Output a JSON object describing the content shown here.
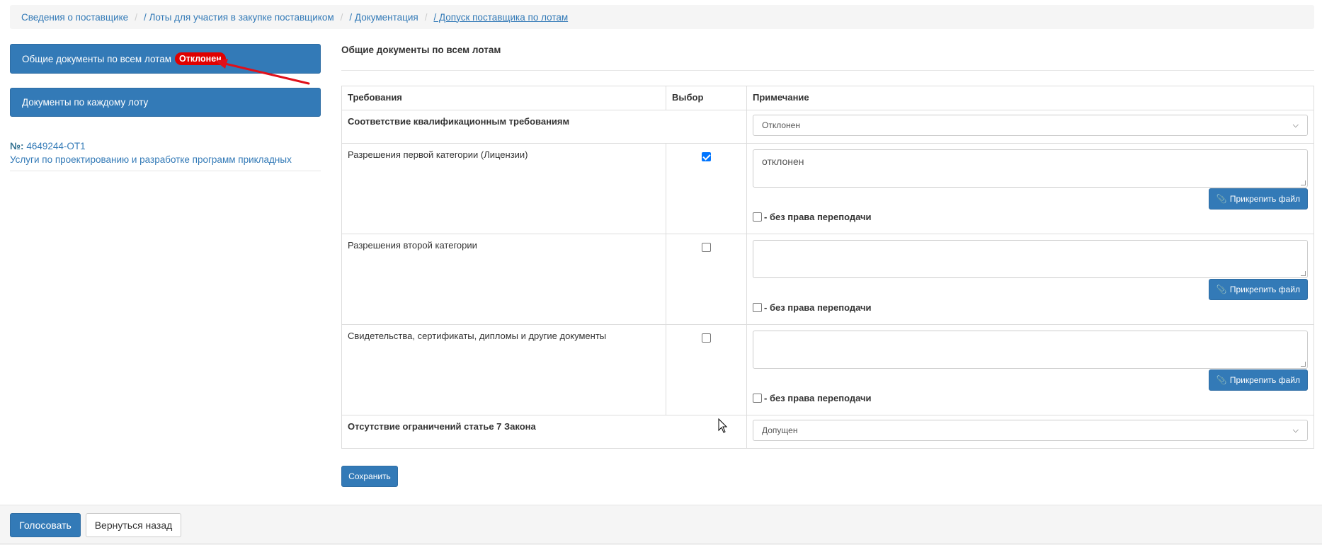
{
  "breadcrumb": {
    "items": [
      {
        "label": "Сведения о поставщике"
      },
      {
        "label": "/ Лоты для участия в закупке поставщиком"
      },
      {
        "label": "/ Документация"
      },
      {
        "label": "/ Допуск поставщика по лотам"
      }
    ],
    "separator": "/"
  },
  "sidebar": {
    "general_docs_label": "Общие документы по всем лотам",
    "general_docs_badge": "Отклонен",
    "per_lot_label": "Документы по каждому лоту",
    "lot_number_prefix": "№:",
    "lot_number": "4649244-ОТ1",
    "lot_title": "Услуги по проектированию и разработке программ прикладных"
  },
  "main": {
    "section_title": "Общие документы по всем лотам",
    "table": {
      "headers": [
        "Требования",
        "Выбор",
        "Примечание"
      ],
      "rows": [
        {
          "type": "group",
          "requirement": "Соответствие квалификационным требованиям",
          "status": "Отклонен"
        },
        {
          "type": "doc",
          "requirement": "Разрешения первой категории (Лицензии)",
          "checked": true,
          "note": "отклонен",
          "attach_label": "Прикрепить файл",
          "noresale_label": "- без права переподачи"
        },
        {
          "type": "doc",
          "requirement": "Разрешения второй категории",
          "checked": false,
          "note": "",
          "attach_label": "Прикрепить файл",
          "noresale_label": "- без права переподачи"
        },
        {
          "type": "doc",
          "requirement": "Свидетельства, сертификаты, дипломы и другие документы",
          "checked": false,
          "note": "",
          "attach_label": "Прикрепить файл",
          "noresale_label": "- без права переподачи"
        },
        {
          "type": "group",
          "requirement": "Отсутствие ограничений статье 7 Закона",
          "status": "Допущен"
        }
      ]
    },
    "save_label": "Сохранить"
  },
  "footer": {
    "vote_label": "Голосовать",
    "back_label": "Вернуться назад"
  },
  "colors": {
    "primary": "#337ab7",
    "badge_red": "#e00000",
    "arrow_red": "#e0101a"
  },
  "icons": [
    "paperclip-icon",
    "chevron-down-icon",
    "arrow-annotation",
    "mouse-cursor-icon"
  ]
}
